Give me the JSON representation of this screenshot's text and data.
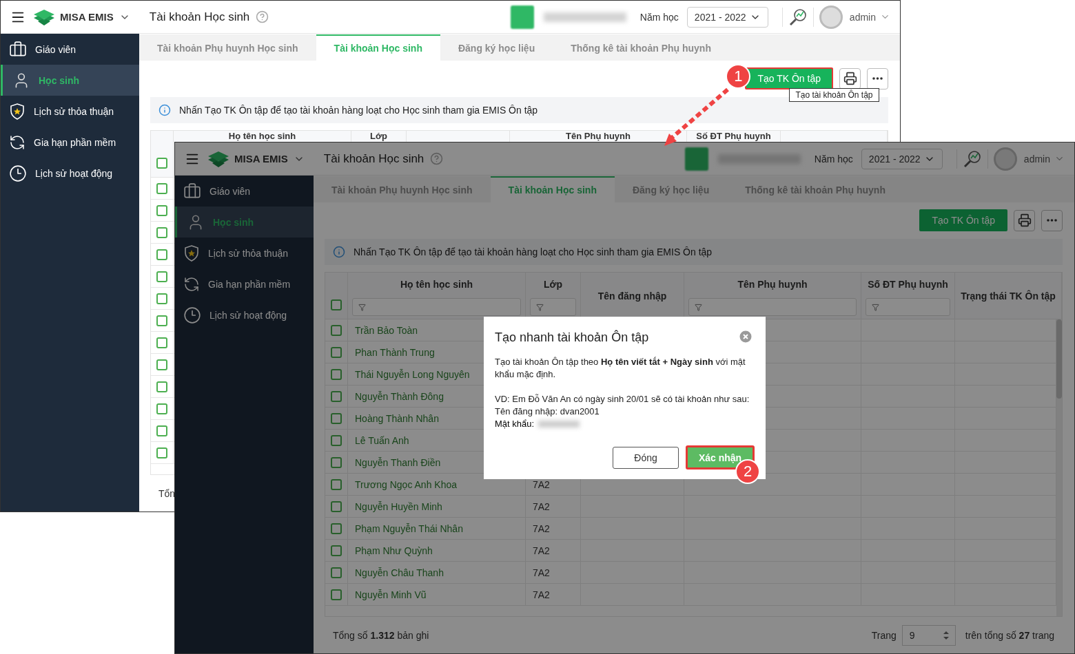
{
  "windows": [
    {
      "header": {
        "app_name": "MISA EMIS",
        "title": "Tài khoản Học sinh",
        "year_label": "Năm học",
        "year_value": "2021 - 2022",
        "user": "admin"
      },
      "sidebar": [
        {
          "label": "Giáo viên",
          "selected": false
        },
        {
          "label": "Học sinh",
          "selected": true
        },
        {
          "label": "Lịch sử thỏa thuận",
          "selected": false
        },
        {
          "label": "Gia hạn phần mềm",
          "selected": false
        },
        {
          "label": "Lịch sử hoạt động",
          "selected": false
        }
      ],
      "tabs": [
        {
          "label": "Tài khoản Phụ huynh Học sinh",
          "selected": false
        },
        {
          "label": "Tài khoản Học sinh",
          "selected": true
        },
        {
          "label": "Đăng ký học liệu",
          "selected": false
        },
        {
          "label": "Thống kê tài khoản Phụ huynh",
          "selected": false
        }
      ],
      "toolbar": {
        "create_button": {
          "label": "Tạo TK Ôn tập",
          "highlighted": true,
          "step": "1"
        },
        "tooltip": "Tạo tài khoản Ôn tập"
      },
      "info": "Nhấn Tạo TK Ôn tập để tạo tài khoản hàng loạt cho Học sinh tham gia EMIS Ôn tập",
      "table": {
        "select_all": {
          "checked": false
        },
        "columns": [
          {
            "kind": "name",
            "label": "Họ tên học sinh"
          },
          {
            "kind": "class",
            "label": "Lớp"
          },
          {
            "kind": "parent",
            "label": "Tên Phụ huynh"
          },
          {
            "kind": "phone",
            "label": "Số ĐT Phụ huynh"
          }
        ],
        "rows": [
          {
            "checked": false
          },
          {
            "checked": false
          },
          {
            "checked": false
          },
          {
            "checked": false
          },
          {
            "checked": false
          },
          {
            "checked": false
          },
          {
            "checked": false
          },
          {
            "checked": false
          },
          {
            "checked": false
          },
          {
            "checked": false
          },
          {
            "checked": false
          },
          {
            "checked": false
          },
          {
            "checked": false
          }
        ]
      },
      "footer": {
        "total": "Tổn"
      }
    },
    {
      "dimmed": true,
      "header": {
        "app_name": "MISA EMIS",
        "title": "Tài khoản Học sinh",
        "year_label": "Năm học",
        "year_value": "2021 - 2022",
        "user": "admin"
      },
      "sidebar": [
        {
          "label": "Giáo viên",
          "selected": false
        },
        {
          "label": "Học sinh",
          "selected": true
        },
        {
          "label": "Lịch sử thỏa thuận",
          "selected": false
        },
        {
          "label": "Gia hạn phần mềm",
          "selected": false
        },
        {
          "label": "Lịch sử hoạt động",
          "selected": false
        }
      ],
      "tabs": [
        {
          "label": "Tài khoản Phụ huynh Học sinh",
          "selected": false
        },
        {
          "label": "Tài khoản Học sinh",
          "selected": true
        },
        {
          "label": "Đăng ký học liệu",
          "selected": false
        },
        {
          "label": "Thống kê tài khoản Phụ huynh",
          "selected": false
        }
      ],
      "toolbar": {
        "create_button": {
          "label": "Tạo TK Ôn tập",
          "highlighted": false
        }
      },
      "info": "Nhấn Tạo TK Ôn tập để tạo tài khoản hàng loạt cho Học sinh tham gia EMIS Ôn tập",
      "table": {
        "select_all": {
          "checked": false
        },
        "scrollbar": true,
        "columns": [
          {
            "kind": "name",
            "label": "Họ tên học sinh",
            "filter": true
          },
          {
            "kind": "class",
            "label": "Lớp",
            "filter": true
          },
          {
            "kind": "username",
            "label": "Tên đăng nhập"
          },
          {
            "kind": "parent",
            "label": "Tên Phụ huynh",
            "filter": true
          },
          {
            "kind": "phone",
            "label": "Số ĐT Phụ huynh",
            "filter": true
          },
          {
            "kind": "status",
            "label": "Trạng thái TK Ôn tập"
          }
        ],
        "rows": [
          {
            "checked": false,
            "name": "Trần Bảo Toàn"
          },
          {
            "checked": false,
            "name": "Phan Thành Trung"
          },
          {
            "checked": false,
            "name": "Thái Nguyễn Long Nguyên"
          },
          {
            "checked": false,
            "name": "Nguyễn Thành Đông"
          },
          {
            "checked": false,
            "name": "Hoàng Thành Nhân"
          },
          {
            "checked": false,
            "name": "Lê Tuấn Anh"
          },
          {
            "checked": false,
            "name": "Nguyễn Thanh Điền"
          },
          {
            "checked": false,
            "name": "Trương Ngọc Anh Khoa",
            "class": "7A2"
          },
          {
            "checked": false,
            "name": "Nguyễn Huyền Minh",
            "class": "7A2"
          },
          {
            "checked": false,
            "name": "Phạm Nguyễn Thái Nhân",
            "class": "7A2"
          },
          {
            "checked": false,
            "name": "Phạm Như Quỳnh",
            "class": "7A2"
          },
          {
            "checked": false,
            "name": "Nguyễn Châu Thanh",
            "class": "7A2"
          },
          {
            "checked": false,
            "name": "Nguyễn Minh Vũ",
            "class": "7A2"
          }
        ]
      },
      "footer": {
        "total": "Tổng số **1.312** bản ghi",
        "page_label": "Trang",
        "page_value": "9",
        "page_total": "trên tổng số **27** trang"
      },
      "modal": {
        "title": "Tạo nhanh tài khoản Ôn tập",
        "message": "Tạo tài khoản Ôn tập theo **Họ tên viết tắt + Ngày sinh** với mật khẩu mặc định.",
        "example": "VD: Em Đỗ Văn An có ngày sinh 20/01 sẽ có tài khoản như sau:",
        "username_line": "Tên đăng nhập: dvan2001",
        "password_label": "Mật khẩu:",
        "buttons": [
          {
            "kind": "secondary",
            "label": "Đóng",
            "highlighted": false
          },
          {
            "kind": "primary",
            "label": "Xác nhận",
            "highlighted": true,
            "step": "2"
          }
        ]
      }
    }
  ]
}
